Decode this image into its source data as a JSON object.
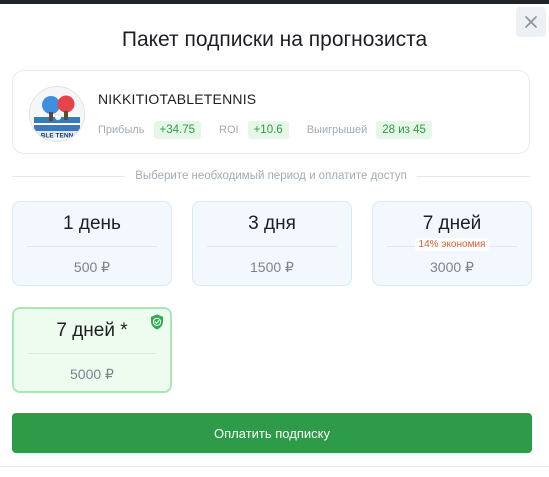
{
  "modal": {
    "title": "Пакет подписки на прогнозиста",
    "close_icon": "close-icon"
  },
  "tipster": {
    "name": "NIKKITIOTABLETENNIS",
    "avatar_text": "BLE TENN",
    "stats": [
      {
        "label": "Прибыль",
        "value": "+34.75"
      },
      {
        "label": "ROI",
        "value": "+10.6"
      },
      {
        "label": "Выигрышей",
        "value": "28 из 45"
      }
    ]
  },
  "period_hint": "Выберите необходимый период и оплатите доступ",
  "plans": [
    {
      "title": "1 день",
      "price": "500 ₽",
      "discount": "",
      "selected": false
    },
    {
      "title": "3 дня",
      "price": "1500 ₽",
      "discount": "",
      "selected": false
    },
    {
      "title": "7 дней",
      "price": "3000 ₽",
      "discount": "14% экономия",
      "selected": false
    },
    {
      "title": "7 дней *",
      "price": "5000 ₽",
      "discount": "",
      "selected": true,
      "badge_icon": "shield-check-icon"
    }
  ],
  "pay_button": "Оплатить подписку",
  "colors": {
    "accent_green": "#2d9b48",
    "stat_badge_bg": "#e6f6e7",
    "stat_badge_text": "#2e9c44",
    "plan_bg": "#f2f8fe",
    "selected_plan_bg": "#edfcef",
    "discount_text": "#e0612f"
  }
}
